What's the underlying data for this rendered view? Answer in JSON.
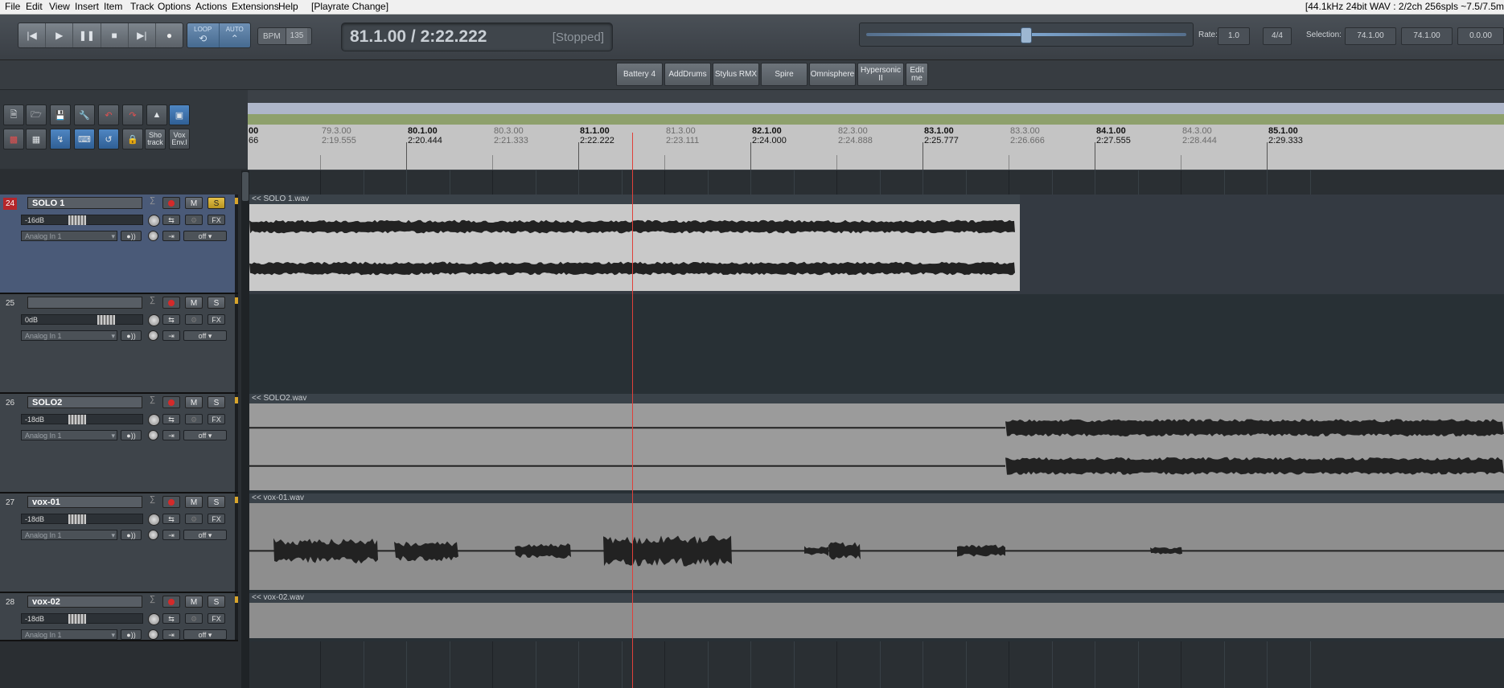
{
  "menubar": {
    "items": [
      "File",
      "Edit",
      "View",
      "Insert",
      "Item",
      "Track",
      "Options",
      "Actions",
      "Extensions",
      "Help",
      "[Playrate Change]"
    ],
    "status": "[44.1kHz 24bit WAV : 2/2ch 256spls ~7.5/7.5m"
  },
  "transport": {
    "buttons": [
      "go-to-start",
      "play",
      "pause",
      "stop",
      "go-to-end",
      "record"
    ],
    "loop_label": "LOOP",
    "auto_label": "AUTO",
    "bpm_label": "BPM",
    "bpm_value": "135",
    "time": "81.1.00 / 2:22.222",
    "state": "[Stopped]",
    "rate_label": "Rate:",
    "rate_value": "1.0",
    "time_sig": "4/4",
    "selection_label": "Selection:",
    "selection_start": "74.1.00",
    "selection_end": "74.1.00",
    "selection_len": "0.0.00"
  },
  "plugins": [
    "Battery 4",
    "AddDrums",
    "Stylus RMX",
    "Spire",
    "Omnisphere",
    "Hypersonic II",
    "Edit me"
  ],
  "toolbar": {
    "sho_track": "Sho track",
    "vox_env": "Vox Env.l"
  },
  "ruler": {
    "markers": [
      {
        "bar": "80",
        "pos": "79.3.00",
        "time": "2:19.555",
        "major": false
      },
      {
        "bar": "80",
        "pos": "80.1.00",
        "time": "2:20.444",
        "major": true
      },
      {
        "bar": "80",
        "pos": "80.3.00",
        "time": "2:21.333",
        "major": false
      },
      {
        "bar": "81",
        "pos": "81.1.00",
        "time": "2:22.222",
        "major": true
      },
      {
        "bar": "81",
        "pos": "81.3.00",
        "time": "2:23.111",
        "major": false
      },
      {
        "bar": "82",
        "pos": "82.1.00",
        "time": "2:24.000",
        "major": true
      },
      {
        "bar": "82",
        "pos": "82.3.00",
        "time": "2:24.888",
        "major": false
      },
      {
        "bar": "83",
        "pos": "83.1.00",
        "time": "2:25.777",
        "major": true
      },
      {
        "bar": "83",
        "pos": "83.3.00",
        "time": "2:26.666",
        "major": false
      },
      {
        "bar": "84",
        "pos": "84.1.00",
        "time": "2:27.555",
        "major": true
      },
      {
        "bar": "84",
        "pos": "84.3.00",
        "time": "2:28.444",
        "major": false
      },
      {
        "bar": "85",
        "pos": "85.1.00",
        "time": "2:29.333",
        "major": true
      }
    ],
    "left_partial_top": "00",
    "left_partial_bottom": "66"
  },
  "tracks": [
    {
      "num": "24",
      "name": "SOLO 1",
      "volume": "-16dB",
      "input": "Analog In 1",
      "automation": "off",
      "armed": true,
      "solo": true,
      "selected": true,
      "item": "<< SOLO 1.wav"
    },
    {
      "num": "25",
      "name": "",
      "volume": "0dB",
      "input": "Analog In 1",
      "automation": "off",
      "armed": false,
      "solo": false,
      "selected": false,
      "item": ""
    },
    {
      "num": "26",
      "name": "SOLO2",
      "volume": "-18dB",
      "input": "Analog In 1",
      "automation": "off",
      "armed": false,
      "solo": false,
      "selected": false,
      "item": "<< SOLO2.wav"
    },
    {
      "num": "27",
      "name": "vox-01",
      "volume": "-18dB",
      "input": "Analog In 1",
      "automation": "off",
      "armed": false,
      "solo": false,
      "selected": false,
      "item": "<< vox-01.wav"
    },
    {
      "num": "28",
      "name": "vox-02",
      "volume": "-18dB",
      "input": "Analog In 1",
      "automation": "off",
      "armed": false,
      "solo": false,
      "selected": false,
      "item": "<< vox-02.wav"
    }
  ],
  "track_buttons": {
    "mute": "M",
    "solo": "S",
    "fx": "FX",
    "io": "I/O"
  },
  "colors": {
    "accent": "#5a87c0",
    "record": "#d42a2a",
    "solo_on": "#d8b43a",
    "playhead": "#e0403a"
  }
}
